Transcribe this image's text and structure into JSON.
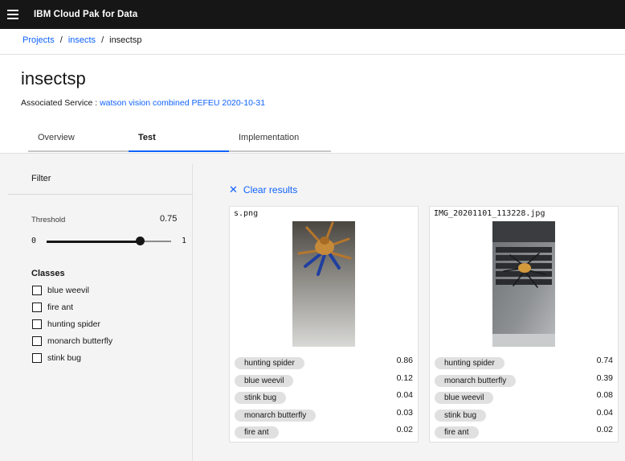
{
  "app": {
    "title": "IBM Cloud Pak for Data"
  },
  "breadcrumb": {
    "items": [
      "Projects",
      "insects",
      "insectsp"
    ],
    "separator": "/"
  },
  "page": {
    "title": "insectsp",
    "assoc_label": "Associated Service :",
    "assoc_link": "watson vision combined PEFEU 2020-10-31"
  },
  "tabs": [
    {
      "label": "Overview",
      "active": false
    },
    {
      "label": "Test",
      "active": true
    },
    {
      "label": "Implementation",
      "active": false
    }
  ],
  "filter": {
    "heading": "Filter",
    "threshold_label": "Threshold",
    "threshold_value": "0.75",
    "threshold_level": 0.75,
    "slider_min": "0",
    "slider_max": "1",
    "classes_heading": "Classes",
    "classes": [
      "blue weevil",
      "fire ant",
      "hunting spider",
      "monarch butterfly",
      "stink bug"
    ]
  },
  "clear_results": {
    "icon": "close-icon",
    "label": "Clear results"
  },
  "cards": [
    {
      "filename": "s.png",
      "results": [
        {
          "label": "hunting spider",
          "score": "0.86"
        },
        {
          "label": "blue weevil",
          "score": "0.12"
        },
        {
          "label": "stink bug",
          "score": "0.04"
        },
        {
          "label": "monarch butterfly",
          "score": "0.03"
        },
        {
          "label": "fire ant",
          "score": "0.02"
        }
      ]
    },
    {
      "filename": "IMG_20201101_113228.jpg",
      "results": [
        {
          "label": "hunting spider",
          "score": "0.74"
        },
        {
          "label": "monarch butterfly",
          "score": "0.39"
        },
        {
          "label": "blue weevil",
          "score": "0.08"
        },
        {
          "label": "stink bug",
          "score": "0.04"
        },
        {
          "label": "fire ant",
          "score": "0.02"
        }
      ]
    }
  ],
  "colors": {
    "link": "#0f62fe",
    "topbar": "#161616",
    "tag": "#e0e0e0"
  }
}
